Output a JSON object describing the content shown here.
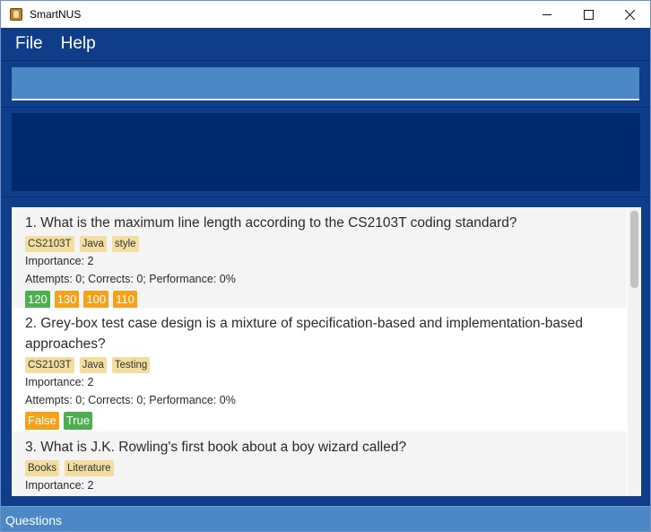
{
  "window": {
    "title": "SmartNUS"
  },
  "menu": {
    "items": [
      "File",
      "Help"
    ]
  },
  "command": {
    "value": "",
    "placeholder": ""
  },
  "result": {
    "text": ""
  },
  "questions": [
    {
      "text": "1. What is the maximum line length according to the CS2103T coding standard?",
      "tags": [
        "CS2103T",
        "Java",
        "style"
      ],
      "importance": "Importance: 2",
      "stats": "Attempts: 0; Corrects: 0; Performance: 0%",
      "options": [
        {
          "label": "120",
          "correct": true
        },
        {
          "label": "130",
          "correct": false
        },
        {
          "label": "100",
          "correct": false
        },
        {
          "label": "110",
          "correct": false
        }
      ]
    },
    {
      "text": "2. Grey-box test case design is a mixture of specification-based and implementation-based approaches?",
      "tags": [
        "CS2103T",
        "Java",
        "Testing"
      ],
      "importance": "Importance: 2",
      "stats": "Attempts: 0; Corrects: 0; Performance: 0%",
      "options": [
        {
          "label": "False",
          "correct": false
        },
        {
          "label": "True",
          "correct": true
        }
      ]
    },
    {
      "text": "3. What is J.K. Rowling's first book about a boy wizard called?",
      "tags": [
        "Books",
        "Literature"
      ],
      "importance": "Importance: 2",
      "stats": "",
      "options": []
    }
  ],
  "status": {
    "text": "Questions"
  },
  "colors": {
    "correct": "#4caf50",
    "wrong": "#f5a21a",
    "tag": "#f2dfa0",
    "accent": "#0f3d8a"
  }
}
